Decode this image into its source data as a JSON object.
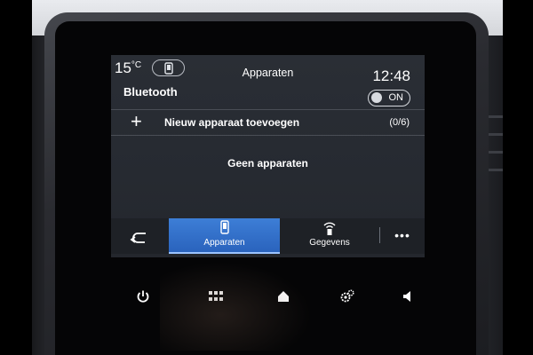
{
  "status": {
    "temperature": "15",
    "temperature_unit": "°C",
    "title": "Apparaten",
    "clock": "12:48"
  },
  "bluetooth": {
    "label": "Bluetooth",
    "toggle_state": "ON"
  },
  "add_device": {
    "label": "Nieuw apparaat toevoegen",
    "count": "(0/6)"
  },
  "empty_message": "Geen apparaten",
  "tabs": {
    "devices_label": "Apparaten",
    "data_label": "Gegevens",
    "more_label": "•••"
  },
  "icons": {
    "back": "back-arrow-icon",
    "phone": "phone-icon",
    "wifi_data": "signal-icon",
    "power": "power-icon",
    "apps": "grid-icon",
    "home": "home-icon",
    "settings": "settings-icon",
    "volume": "speaker-icon"
  },
  "colors": {
    "active_tab": "#3470cc",
    "screen_bg": "#272b32"
  }
}
